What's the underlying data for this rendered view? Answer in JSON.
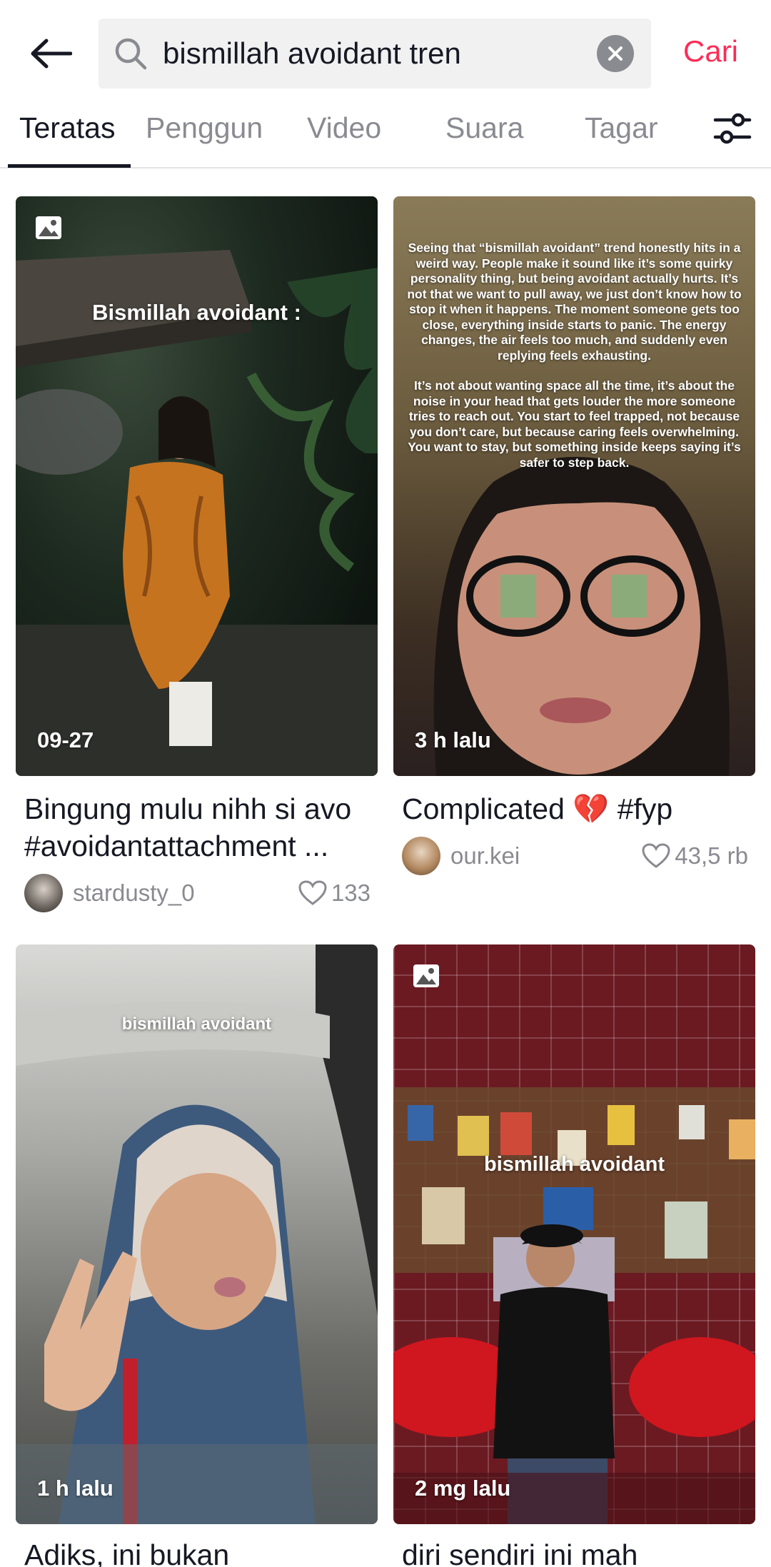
{
  "search": {
    "query": "bismillah avoidant tren",
    "submit_label": "Cari"
  },
  "tabs": [
    {
      "label": "Teratas",
      "active": true
    },
    {
      "label": "Penggun",
      "active": false
    },
    {
      "label": "Video",
      "active": false
    },
    {
      "label": "Suara",
      "active": false
    },
    {
      "label": "Tagar",
      "active": false
    }
  ],
  "icons": {
    "back": "arrow-left-icon",
    "search": "search-icon",
    "clear": "close-icon",
    "filter": "sliders-icon",
    "photo": "image-icon",
    "like": "heart-icon"
  },
  "colors": {
    "accent": "#fe2c55",
    "muted": "#8a8b91",
    "text": "#161823"
  },
  "results": [
    {
      "overlay": "Bismillah avoidant :",
      "time": "09-27",
      "caption_line1": "Bingung mulu nihh si avo",
      "caption_line2": "#avoidantattachment ...",
      "username": "stardusty_0",
      "likes": "133",
      "is_photo": true
    },
    {
      "overlay_p1": "Seeing that “bismillah avoidant” trend honestly hits in a weird way. People make it sound like it’s some quirky personality thing, but being avoidant actually hurts. It’s not that we want to pull away, we just don’t know how to stop it when it happens. The moment someone gets too close, everything inside starts to panic. The energy changes, the air feels too much, and suddenly even replying feels exhausting.",
      "overlay_p2": "It’s not about wanting space all the time, it’s about the noise in your head that gets louder the more someone tries to reach out. You start to feel trapped, not because you don’t care, but because caring feels overwhelming. You want to stay, but something inside keeps saying it’s safer to step back.",
      "time": "3 h lalu",
      "caption": "Complicated 💔 #fyp",
      "username": "our.kei",
      "likes": "43,5 rb",
      "is_photo": false
    },
    {
      "overlay": "bismillah avoidant",
      "time": "1 h lalu",
      "caption": "Adiks, ini bukan",
      "is_photo": false
    },
    {
      "overlay": "bismillah avoidant",
      "time": "2 mg lalu",
      "caption": "diri sendiri ini mah",
      "is_photo": true
    }
  ]
}
